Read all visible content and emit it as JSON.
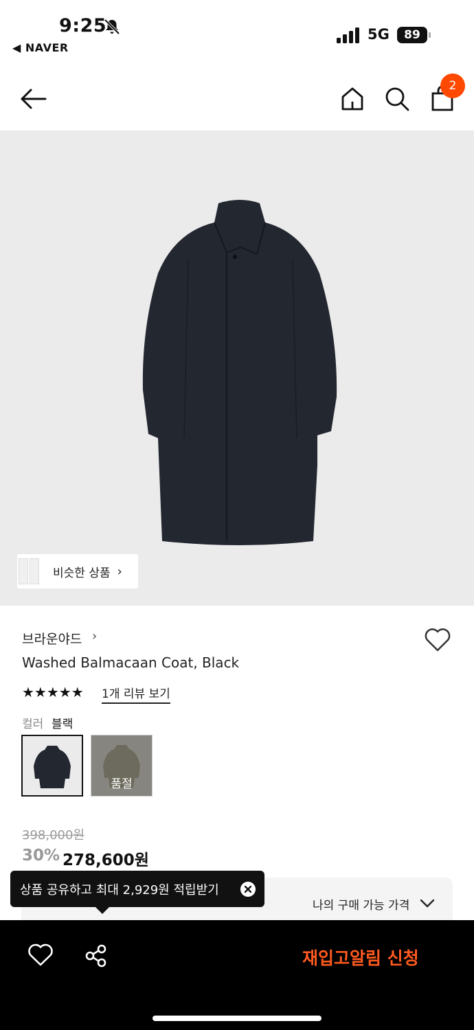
{
  "status_bar": {
    "time": "9:25",
    "back_app": "◀ NAVER",
    "network": "5G",
    "battery": "89"
  },
  "header": {
    "cart_count": "2"
  },
  "hero": {
    "similar_label": "비슷한 상품",
    "similar_chevron": "›"
  },
  "product": {
    "brand": "브라운야드",
    "brand_chevron": "›",
    "title": "Washed Balmacaan Coat, Black",
    "stars": "★★★★★",
    "rating": 5,
    "review_link": "1개 리뷰 보기",
    "color_label": "컬러",
    "color_value": "블랙",
    "sold_out_label": "품절",
    "original_price": "398,000원",
    "discount": "30%",
    "price": "278,600원"
  },
  "my_price": {
    "label": "나의 구매 가능 가격"
  },
  "tooltip": {
    "text": "상품 공유하고 최대 2,929원 적립받기"
  },
  "bottom_bar": {
    "cta": "재입고알림 신청"
  },
  "colors": {
    "accent": "#ff5a1f",
    "badge": "#ff4800",
    "hero_bg": "#ebebeb",
    "coat": "#232730"
  },
  "icons": [
    "bell-slash-icon",
    "signal-icon",
    "battery-icon",
    "back-arrow-icon",
    "home-icon",
    "search-icon",
    "shopping-bag-icon",
    "heart-icon",
    "share-icon",
    "close-icon",
    "chevron-down-icon"
  ]
}
